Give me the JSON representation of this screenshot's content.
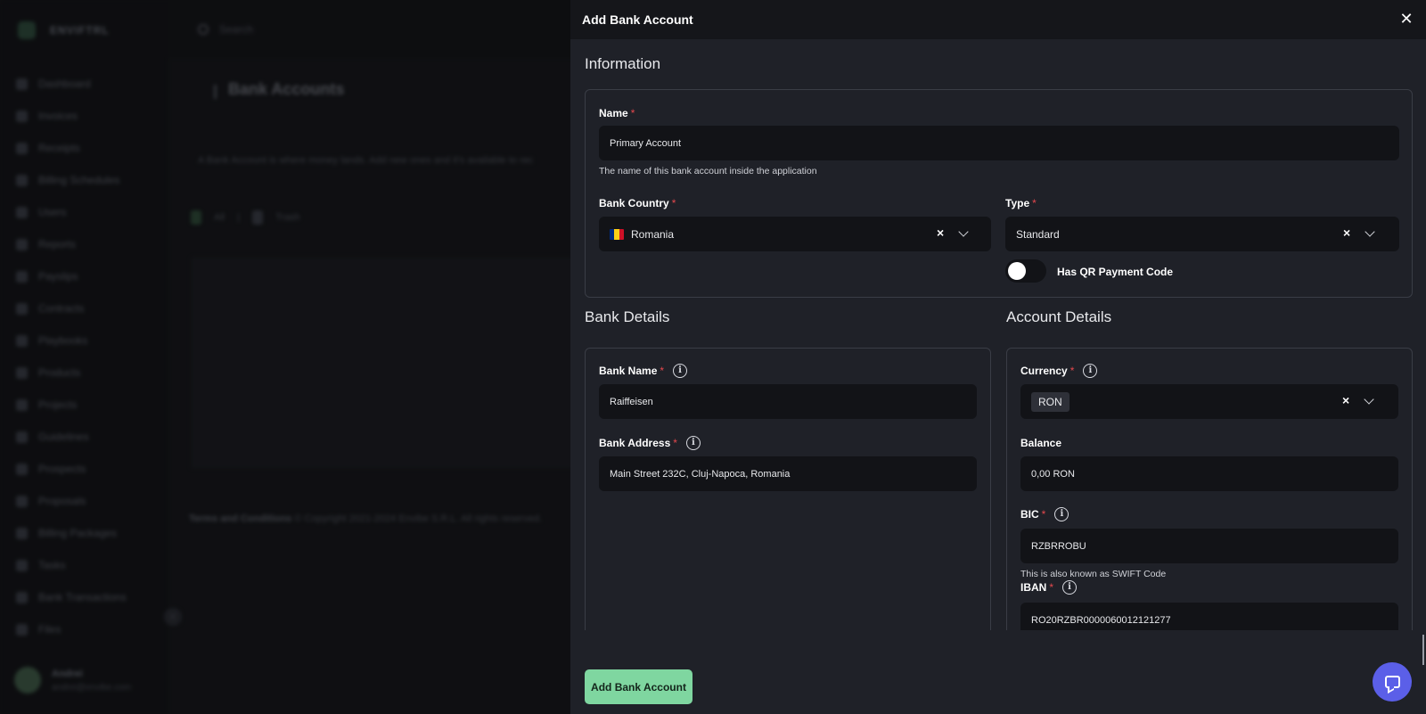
{
  "background": {
    "brand": "ENVIFTRL",
    "search_placeholder": "Search",
    "nav_items": [
      "Dashboard",
      "Invoices",
      "Receipts",
      "Billing Schedules",
      "Users",
      "Reports",
      "Payslips",
      "Contracts",
      "Playbooks",
      "Products",
      "Projects",
      "Guidelines",
      "Prospects",
      "Proposals",
      "Billing Packages",
      "Tasks",
      "Bank Transactions",
      "Files"
    ],
    "page_title": "Bank Accounts",
    "info_text": "A Bank Account is where money lands. Add new ones and it's available to rec",
    "action_all": "All",
    "action_trash": "Trash",
    "footer_terms": "Terms and Conditions",
    "footer_copyright": "© Copyright 2021-2024 Envibe S.R.L. All rights reserved.",
    "user_name": "Andrei",
    "user_email": "andrei@envibe.com"
  },
  "modal": {
    "title": "Add Bank Account",
    "close_icon": "close-icon",
    "information": {
      "section_title": "Information",
      "name_label": "Name",
      "name_value": "Primary Account",
      "name_help": "The name of this bank account inside the application",
      "country_label": "Bank Country",
      "country_value": "Romania",
      "country_flag_colors": [
        "#002b7f",
        "#fcd116",
        "#ce1126"
      ],
      "type_label": "Type",
      "type_value": "Standard",
      "qr_label": "Has QR Payment Code",
      "qr_enabled": false
    },
    "bank_details": {
      "section_title": "Bank Details",
      "bank_name_label": "Bank Name",
      "bank_name_value": "Raiffeisen",
      "bank_address_label": "Bank Address",
      "bank_address_value": "Main Street 232C, Cluj-Napoca, Romania"
    },
    "account_details": {
      "section_title": "Account Details",
      "currency_label": "Currency",
      "currency_value": "RON",
      "balance_label": "Balance",
      "balance_value": "0,00 RON",
      "bic_label": "BIC",
      "bic_value": "RZBRROBU",
      "bic_help": "This is also known as SWIFT Code",
      "iban_label": "IBAN",
      "iban_value": "RO20RZBR0000060012121277"
    },
    "submit_label": "Add Bank Account",
    "required_mark": "*"
  },
  "colors": {
    "accent_green": "#7fd6a0",
    "chat_fab": "#5b5fe8",
    "required": "#e5484d"
  }
}
